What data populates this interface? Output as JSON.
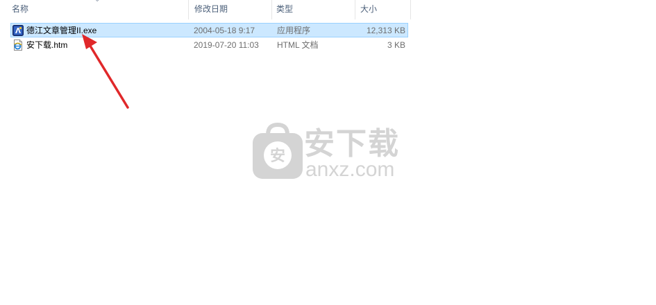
{
  "columns": {
    "name": "名称",
    "modified": "修改日期",
    "type": "类型",
    "size": "大小"
  },
  "sort_indicator": "chevron-up-icon",
  "files": [
    {
      "name": "德江文章管理II.exe",
      "modified": "2004-05-18 9:17",
      "type": "应用程序",
      "size": "12,313 KB",
      "icon": "application-icon",
      "selected": true
    },
    {
      "name": "安下载.htm",
      "modified": "2019-07-20 11:03",
      "type": "HTML 文档",
      "size": "3 KB",
      "icon": "html-document-icon",
      "selected": false
    }
  ],
  "watermark": {
    "badge_text": "安",
    "title": "安下载",
    "domain": "anxz.com"
  },
  "colors": {
    "selection_bg": "#cce8ff",
    "selection_border": "#99d1ff",
    "arrow": "#e0282a",
    "header_text": "#4c607a",
    "watermark": "#d4d4d4"
  }
}
